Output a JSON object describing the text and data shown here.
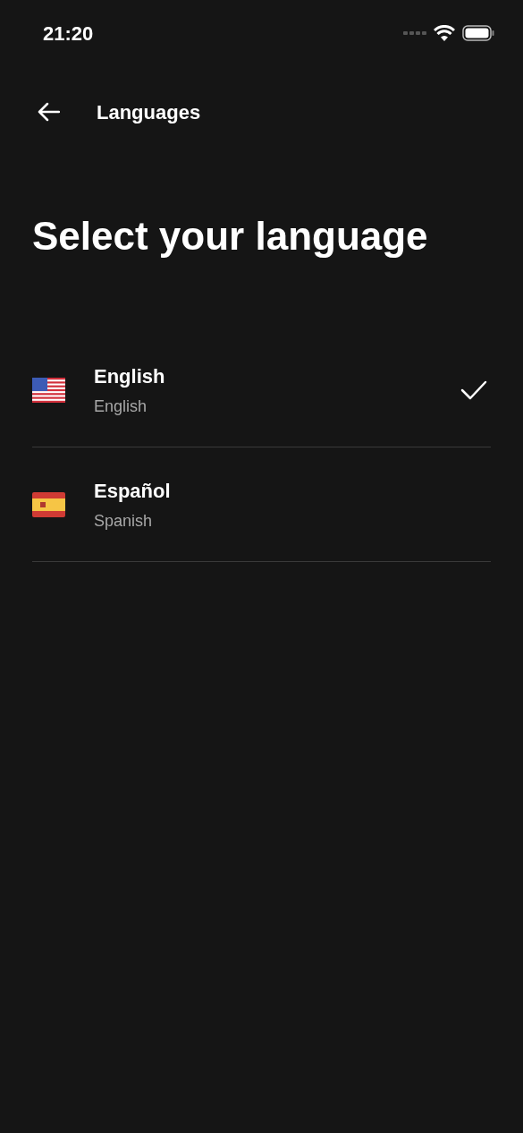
{
  "status_bar": {
    "time": "21:20"
  },
  "header": {
    "title": "Languages"
  },
  "heading": "Select your language",
  "languages": [
    {
      "kind": "us",
      "name": "English",
      "subtitle": "English",
      "selected": true
    },
    {
      "kind": "es",
      "name": "Español",
      "subtitle": "Spanish",
      "selected": false
    }
  ]
}
